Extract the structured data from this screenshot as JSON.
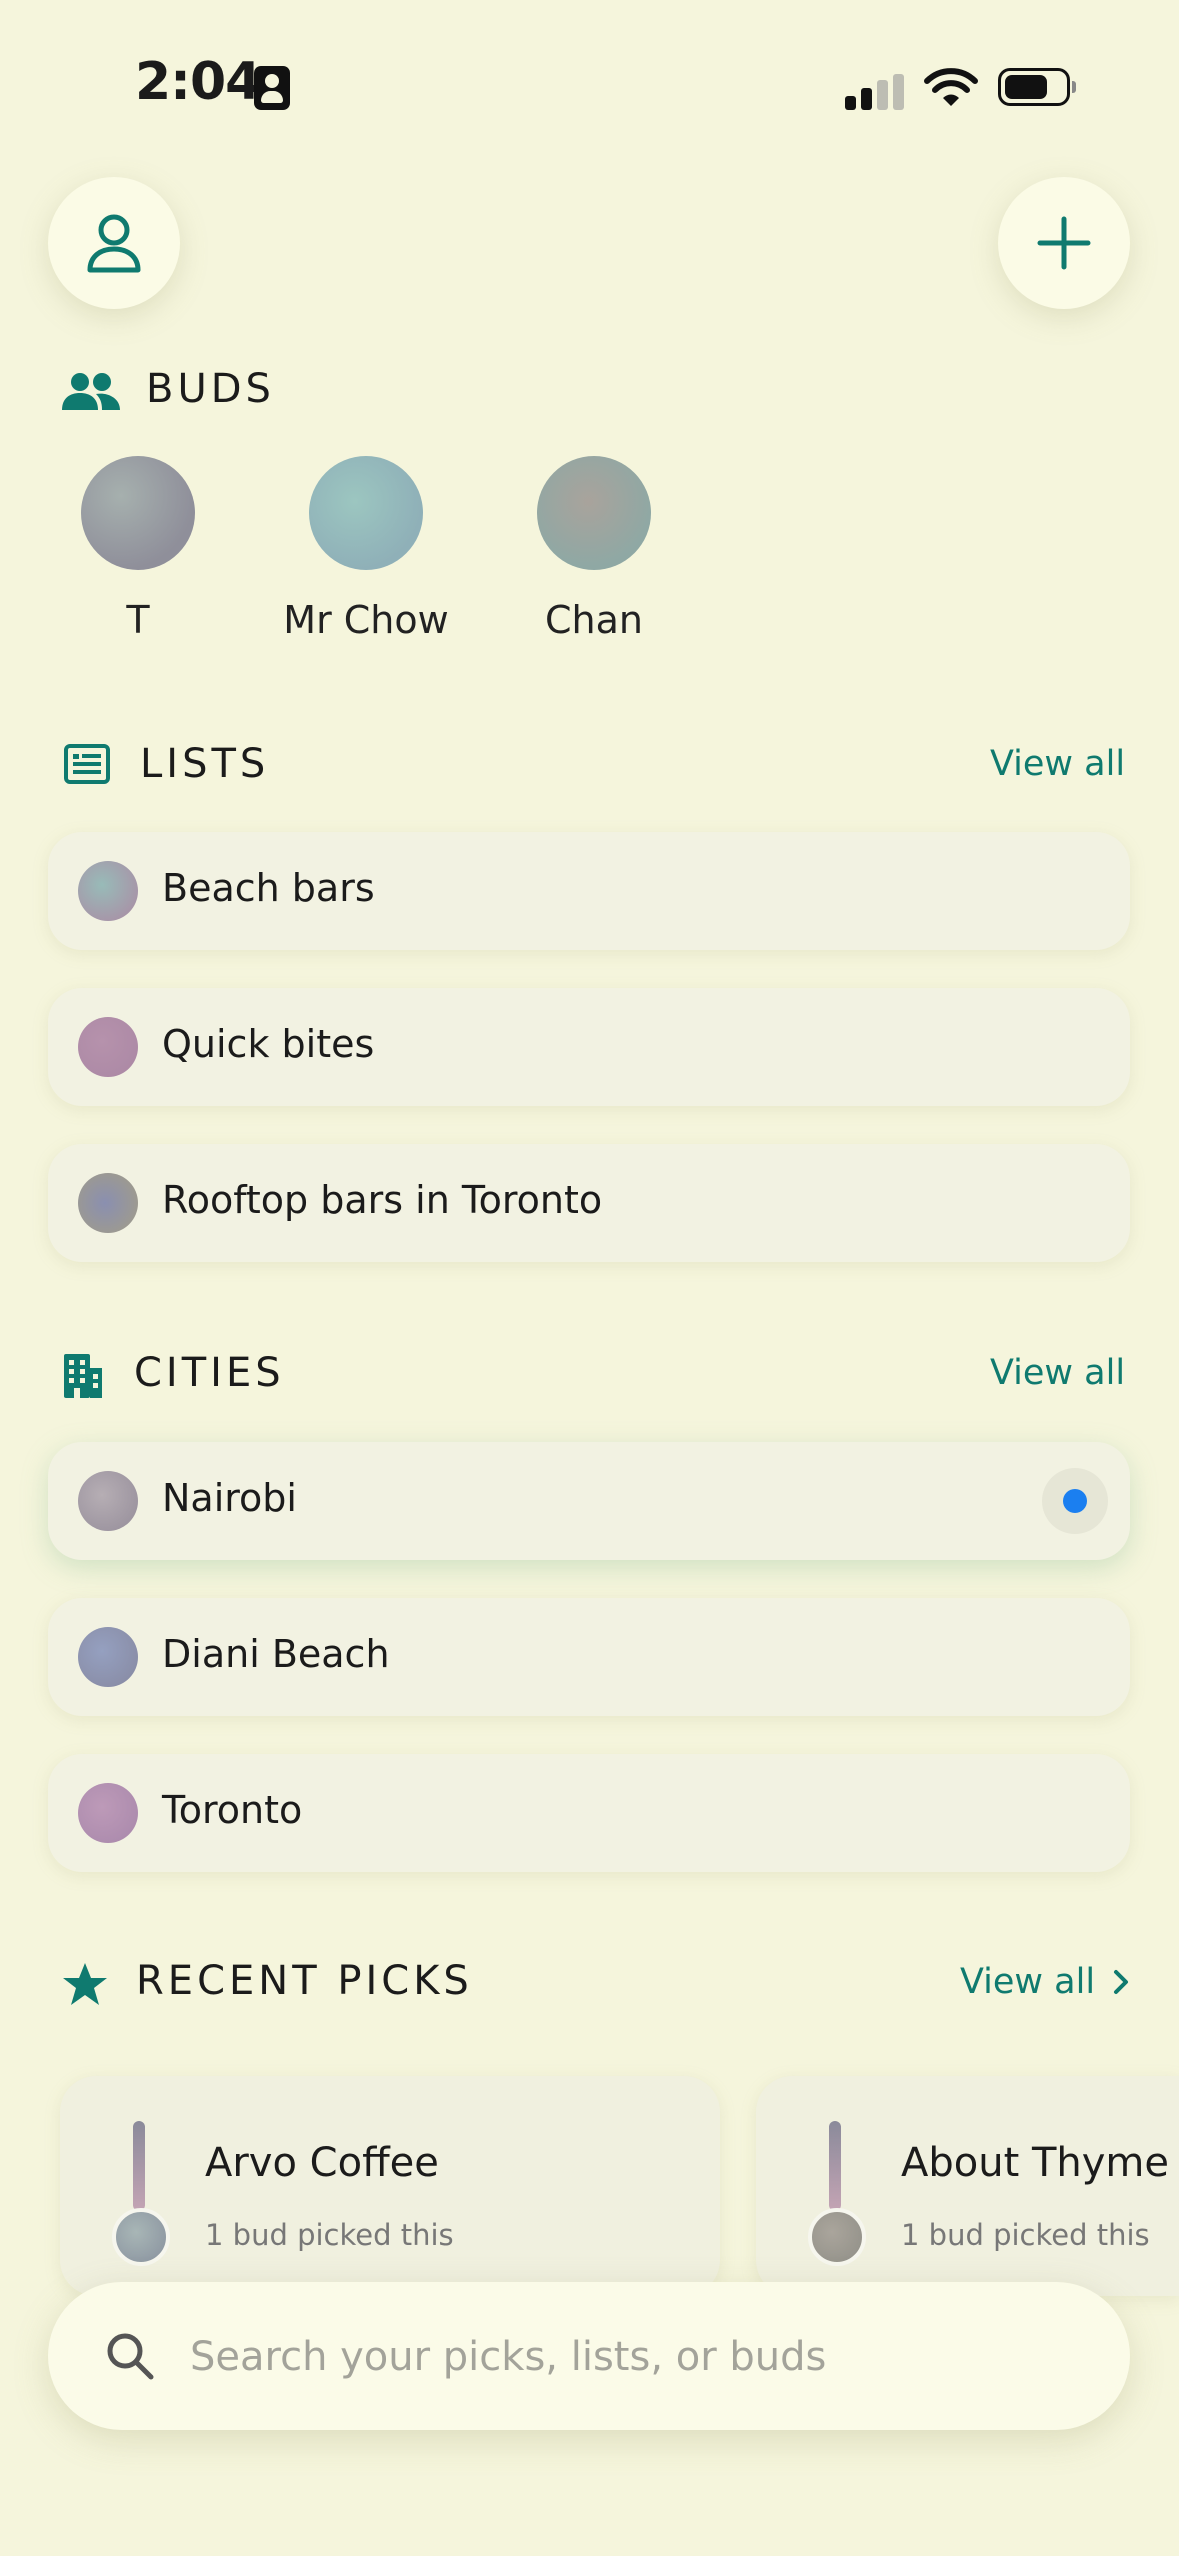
{
  "status_bar": {
    "time": "2:04"
  },
  "buds": {
    "title": "BUDS",
    "items": [
      {
        "name": "T",
        "color": "#93a0a0"
      },
      {
        "name": "Mr Chow",
        "color": "#8fb8b5"
      },
      {
        "name": "Chan",
        "color": "#9fa29a"
      }
    ]
  },
  "lists": {
    "title": "LISTS",
    "view_all": "View all",
    "items": [
      {
        "label": "Beach bars",
        "color": "#a0a8b8"
      },
      {
        "label": "Quick bites",
        "color": "#b08ba8"
      },
      {
        "label": "Rooftop bars in Toronto",
        "color": "#8d8fa0"
      }
    ]
  },
  "cities": {
    "title": "CITIES",
    "view_all": "View all",
    "items": [
      {
        "label": "Nairobi",
        "color": "#a49ea8",
        "has_notification": true
      },
      {
        "label": "Diani Beach",
        "color": "#8f95b4"
      },
      {
        "label": "Toronto",
        "color": "#b692b2"
      }
    ]
  },
  "recent_picks": {
    "title": "RECENT PICKS",
    "view_all": "View all",
    "items": [
      {
        "name": "Arvo Coffee",
        "subtitle": "1 bud picked this",
        "color": "#99a6ac"
      },
      {
        "name": "About Thyme",
        "subtitle": "1 bud picked this",
        "color": "#a09e94"
      }
    ]
  },
  "search": {
    "placeholder": "Search your picks, lists, or buds"
  },
  "colors": {
    "accent": "#0f7a6f",
    "background": "#f5f5dc",
    "notification": "#1b7ff0"
  },
  "icons": [
    "contact-card-icon",
    "signal-icon",
    "wifi-icon",
    "battery-icon",
    "profile-icon",
    "plus-icon",
    "people-icon",
    "list-icon",
    "city-icon",
    "star-icon",
    "chevron-right-icon",
    "search-icon"
  ]
}
